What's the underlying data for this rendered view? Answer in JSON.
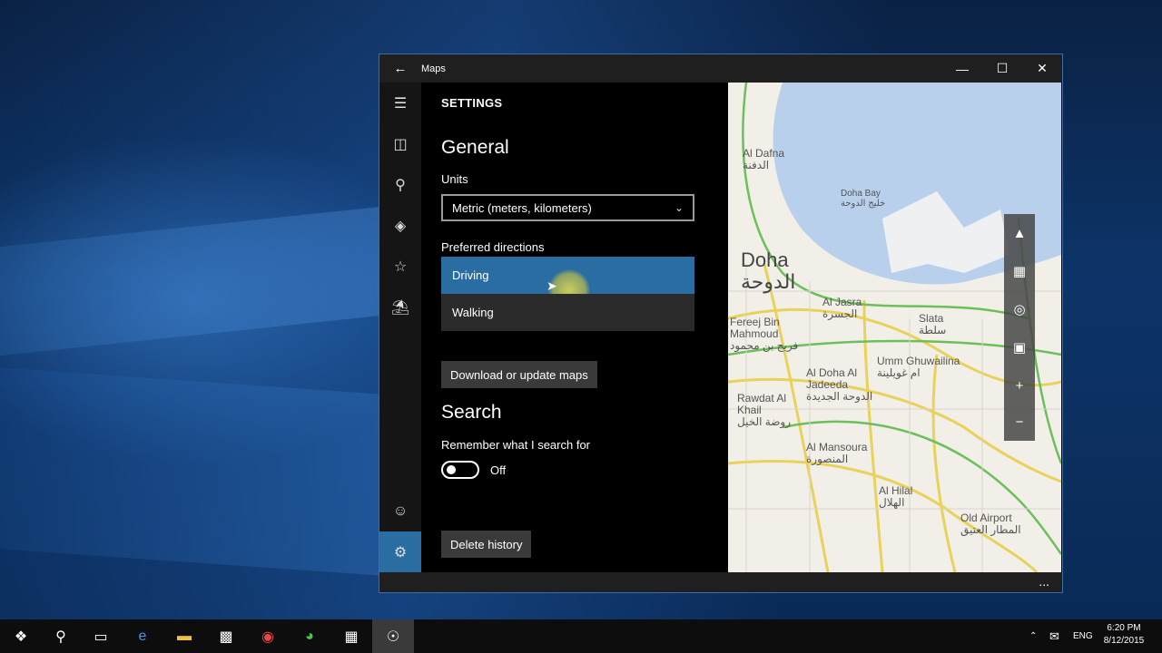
{
  "window": {
    "title": "Maps",
    "back_icon": "back-arrow-icon",
    "controls": [
      "minimize-icon",
      "maximize-icon",
      "close-icon"
    ]
  },
  "rail": {
    "items": [
      {
        "icon": "hamburger-menu-icon"
      },
      {
        "icon": "map-icon"
      },
      {
        "icon": "search-icon"
      },
      {
        "icon": "directions-icon"
      },
      {
        "icon": "star-icon"
      },
      {
        "icon": "3d-cities-icon"
      },
      {
        "icon": "account-icon"
      },
      {
        "icon": "settings-gear-icon",
        "active": true
      }
    ]
  },
  "settings": {
    "title": "SETTINGS",
    "general": {
      "heading": "General",
      "units_label": "Units",
      "units_value": "Metric (meters, kilometers)",
      "directions_label": "Preferred directions",
      "directions_options": [
        {
          "label": "Driving",
          "selected": true
        },
        {
          "label": "Walking",
          "selected": false
        }
      ],
      "download_button": "Download or update maps"
    },
    "search": {
      "heading": "Search",
      "remember_label": "Remember what I search for",
      "toggle_state": "Off",
      "delete_button": "Delete history"
    }
  },
  "map": {
    "labels": [
      {
        "en": "Al Dafna",
        "ar": "الدفنة"
      },
      {
        "en": "Doha Bay",
        "ar": "خليج الدوحة"
      },
      {
        "en": "Doha",
        "ar": "الدوحة"
      },
      {
        "en": "Al Jasra",
        "ar": "الجسرة"
      },
      {
        "en": "Slata",
        "ar": "سلطة"
      },
      {
        "en": "Fereej Bin Mahmoud",
        "ar": "فريج بن محمود"
      },
      {
        "en": "Al Doha Al Jadeeda",
        "ar": "الدوحة الجديدة"
      },
      {
        "en": "Umm Ghuwailina",
        "ar": "ام غويلينة"
      },
      {
        "en": "Rawdat Al Khail",
        "ar": "روضة الخيل"
      },
      {
        "en": "Al Mansoura",
        "ar": "المنصورة"
      },
      {
        "en": "Al Hilal",
        "ar": "الهلال"
      },
      {
        "en": "Old Airport",
        "ar": "المطار العتيق"
      }
    ],
    "tools": [
      "compass-icon",
      "3d-view-icon",
      "locate-me-icon",
      "map-layers-icon",
      "zoom-in-icon",
      "zoom-out-icon"
    ]
  },
  "bottom_bar": {
    "more": "..."
  },
  "taskbar": {
    "items": [
      "start-windows-icon",
      "search-icon",
      "task-view-icon",
      "edge-browser-icon",
      "file-explorer-icon",
      "store-icon",
      "chrome-icon",
      "camtasia-icon",
      "calculator-icon",
      "maps-app-icon"
    ],
    "tray": {
      "language": "ENG",
      "time": "6:20 PM",
      "date": "8/12/2015"
    }
  }
}
